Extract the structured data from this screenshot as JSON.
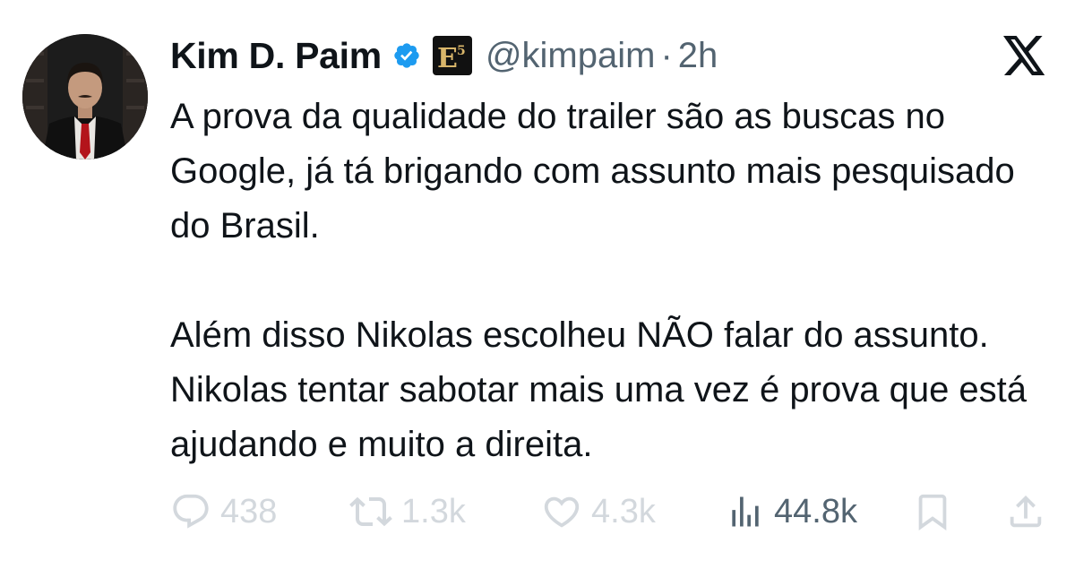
{
  "author": {
    "display_name": "Kim D. Paim",
    "handle": "@kimpaim",
    "separator": "·",
    "time": "2h",
    "affiliation_badge_text": "E5",
    "avatar": "profile-photo"
  },
  "icons": {
    "verified": "verified-badge-icon",
    "affiliation": "affiliation-badge-icon",
    "platform": "x-logo-icon"
  },
  "tweet": {
    "paragraphs": [
      "A prova da qualidade do trailer são as buscas no Google, já tá brigando com assunto mais pesquisado do Brasil.",
      "Além disso Nikolas escolheu NÃO falar do assunto. Nikolas tentar sabotar mais uma vez é prova que está ajudando e muito a direita."
    ]
  },
  "actions": {
    "replies": "438",
    "reposts": "1.3k",
    "likes": "4.3k",
    "views": "44.8k"
  },
  "colors": {
    "verified_blue": "#1d9bf0",
    "text_primary": "#0f1419",
    "text_secondary": "#536471",
    "faded_action": "#d3d8dd"
  }
}
